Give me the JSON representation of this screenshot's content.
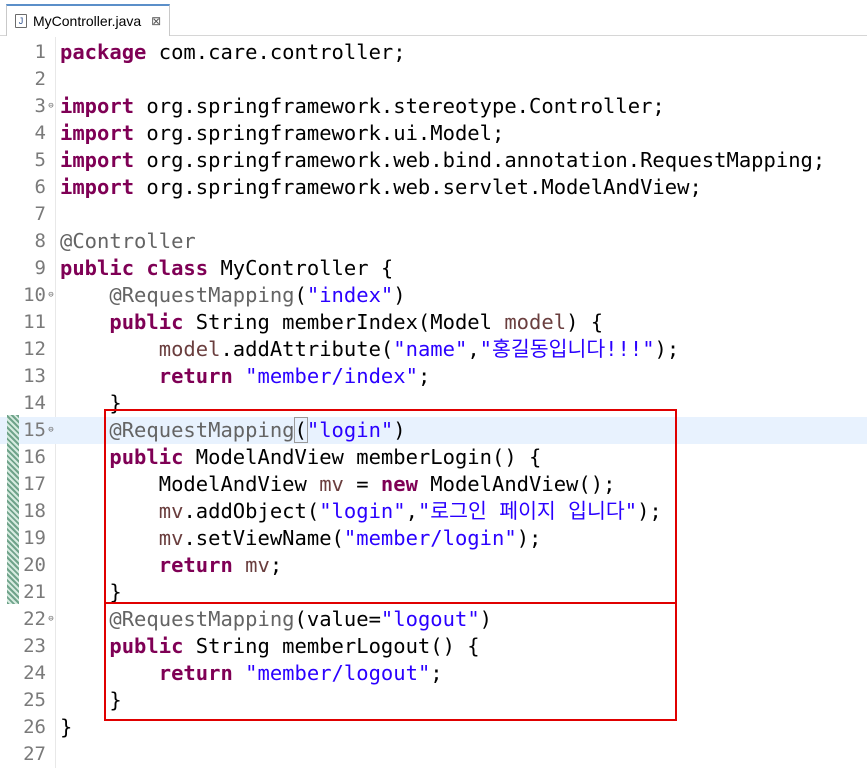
{
  "tab": {
    "title": "MyController.java",
    "close_glyph": "⊠"
  },
  "lines": [
    {
      "num": "1",
      "tokens": [
        {
          "t": "package",
          "c": "kw"
        },
        {
          "t": " com.care.controller;"
        }
      ]
    },
    {
      "num": "2",
      "tokens": []
    },
    {
      "num": "3",
      "fold": true,
      "tokens": [
        {
          "t": "import",
          "c": "kw"
        },
        {
          "t": " org.springframework.stereotype.Controller;"
        }
      ]
    },
    {
      "num": "4",
      "tokens": [
        {
          "t": "import",
          "c": "kw"
        },
        {
          "t": " org.springframework.ui.Model;"
        }
      ]
    },
    {
      "num": "5",
      "tokens": [
        {
          "t": "import",
          "c": "kw"
        },
        {
          "t": " org.springframework.web.bind.annotation.RequestMapping;"
        }
      ]
    },
    {
      "num": "6",
      "tokens": [
        {
          "t": "import",
          "c": "kw"
        },
        {
          "t": " org.springframework.web.servlet.ModelAndView;"
        }
      ]
    },
    {
      "num": "7",
      "tokens": []
    },
    {
      "num": "8",
      "tokens": [
        {
          "t": "@Controller",
          "c": "ann"
        }
      ]
    },
    {
      "num": "9",
      "tokens": [
        {
          "t": "public",
          "c": "kw"
        },
        {
          "t": " "
        },
        {
          "t": "class",
          "c": "kw"
        },
        {
          "t": " MyController {"
        }
      ]
    },
    {
      "num": "10",
      "fold": true,
      "tokens": [
        {
          "t": "    "
        },
        {
          "t": "@RequestMapping",
          "c": "ann"
        },
        {
          "t": "("
        },
        {
          "t": "\"index\"",
          "c": "str"
        },
        {
          "t": ")"
        }
      ]
    },
    {
      "num": "11",
      "tokens": [
        {
          "t": "    "
        },
        {
          "t": "public",
          "c": "kw"
        },
        {
          "t": " String memberIndex(Model "
        },
        {
          "t": "model",
          "c": "var"
        },
        {
          "t": ") {"
        }
      ]
    },
    {
      "num": "12",
      "tokens": [
        {
          "t": "        "
        },
        {
          "t": "model",
          "c": "var"
        },
        {
          "t": ".addAttribute("
        },
        {
          "t": "\"name\"",
          "c": "str"
        },
        {
          "t": ","
        },
        {
          "t": "\"홍길동입니다!!!\"",
          "c": "str"
        },
        {
          "t": ");"
        }
      ]
    },
    {
      "num": "13",
      "tokens": [
        {
          "t": "        "
        },
        {
          "t": "return",
          "c": "kw"
        },
        {
          "t": " "
        },
        {
          "t": "\"member/index\"",
          "c": "str"
        },
        {
          "t": ";"
        }
      ]
    },
    {
      "num": "14",
      "tokens": [
        {
          "t": "    }"
        }
      ]
    },
    {
      "num": "15",
      "fold": true,
      "highlight": true,
      "tokens": [
        {
          "t": "    "
        },
        {
          "t": "@RequestMapping",
          "c": "ann"
        },
        {
          "t": "(",
          "c": "bracket"
        },
        {
          "t": "\"login\"",
          "c": "str"
        },
        {
          "t": ")"
        }
      ]
    },
    {
      "num": "16",
      "tokens": [
        {
          "t": "    "
        },
        {
          "t": "public",
          "c": "kw"
        },
        {
          "t": " ModelAndView memberLogin() {"
        }
      ]
    },
    {
      "num": "17",
      "tokens": [
        {
          "t": "        ModelAndView "
        },
        {
          "t": "mv",
          "c": "var"
        },
        {
          "t": " = "
        },
        {
          "t": "new",
          "c": "kw"
        },
        {
          "t": " ModelAndView();"
        }
      ]
    },
    {
      "num": "18",
      "tokens": [
        {
          "t": "        "
        },
        {
          "t": "mv",
          "c": "var"
        },
        {
          "t": ".addObject("
        },
        {
          "t": "\"login\"",
          "c": "str"
        },
        {
          "t": ","
        },
        {
          "t": "\"로그인 페이지 입니다\"",
          "c": "str"
        },
        {
          "t": ");"
        }
      ]
    },
    {
      "num": "19",
      "tokens": [
        {
          "t": "        "
        },
        {
          "t": "mv",
          "c": "var"
        },
        {
          "t": ".setViewName("
        },
        {
          "t": "\"member/login\"",
          "c": "str"
        },
        {
          "t": ");"
        }
      ]
    },
    {
      "num": "20",
      "tokens": [
        {
          "t": "        "
        },
        {
          "t": "return",
          "c": "kw"
        },
        {
          "t": " "
        },
        {
          "t": "mv",
          "c": "var"
        },
        {
          "t": ";"
        }
      ]
    },
    {
      "num": "21",
      "tokens": [
        {
          "t": "    }"
        }
      ]
    },
    {
      "num": "22",
      "fold": true,
      "tokens": [
        {
          "t": "    "
        },
        {
          "t": "@RequestMapping",
          "c": "ann"
        },
        {
          "t": "(value="
        },
        {
          "t": "\"logout\"",
          "c": "str"
        },
        {
          "t": ")"
        }
      ]
    },
    {
      "num": "23",
      "tokens": [
        {
          "t": "    "
        },
        {
          "t": "public",
          "c": "kw"
        },
        {
          "t": " String memberLogout() {"
        }
      ]
    },
    {
      "num": "24",
      "tokens": [
        {
          "t": "        "
        },
        {
          "t": "return",
          "c": "kw"
        },
        {
          "t": " "
        },
        {
          "t": "\"member/logout\"",
          "c": "str"
        },
        {
          "t": ";"
        }
      ]
    },
    {
      "num": "25",
      "tokens": [
        {
          "t": "    }"
        }
      ]
    },
    {
      "num": "26",
      "tokens": [
        {
          "t": "}"
        }
      ]
    },
    {
      "num": "27",
      "tokens": []
    }
  ],
  "colors": {
    "keyword": "#7f0055",
    "string": "#2a00ff",
    "annotation": "#646464",
    "variable": "#6a3e3e",
    "highlight_line": "#e8f2fe",
    "annotation_box": "#e00000"
  },
  "icons": {
    "file": "java-file-icon",
    "close": "close-tab-icon",
    "fold": "fold-collapse-icon"
  }
}
